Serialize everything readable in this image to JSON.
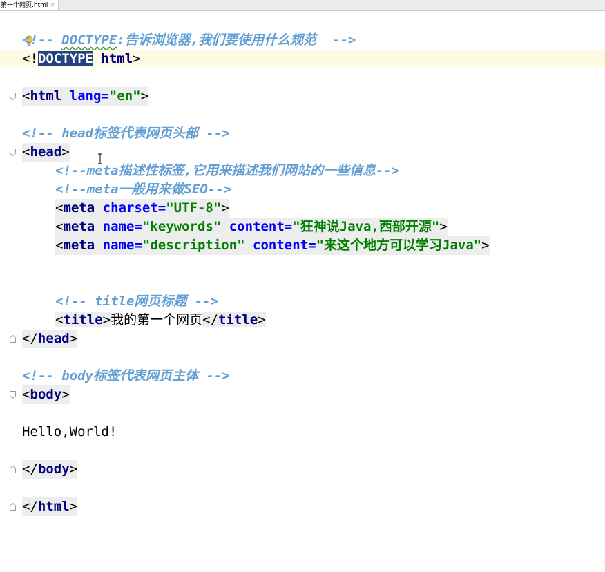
{
  "tab": {
    "title": "第一个网页.html",
    "close": "×"
  },
  "lines": {
    "l1": {
      "a": "<",
      "b": "!-- ",
      "c": "DOCTYPE",
      "d": ":告诉浏览器,我们要使用什么规范  -->"
    },
    "l2": {
      "a": "<!",
      "b": "DOCTYPE",
      "c": " ",
      "d": "html",
      "e": ">"
    },
    "l4": {
      "a": "<",
      "b": "html",
      "c": " ",
      "d": "lang=",
      "e": "\"en\"",
      "f": ">"
    },
    "l6": {
      "text": "<!-- head标签代表网页头部 -->"
    },
    "l7": {
      "a": "<",
      "b": "head",
      "c": ">"
    },
    "l8": {
      "text": "<!--meta描述性标签,它用来描述我们网站的一些信息-->"
    },
    "l9": {
      "text": "<!--meta一般用来做SEO-->"
    },
    "l10": {
      "a": "<",
      "b": "meta",
      "c": " ",
      "d": "charset=",
      "e": "\"UTF-8\"",
      "f": ">"
    },
    "l11": {
      "a": "<",
      "b": "meta",
      "c": " ",
      "d": "name=",
      "e": "\"keywords\"",
      "f": " ",
      "g": "content=",
      "h": "\"狂神说Java,西部开源\"",
      "i": ">"
    },
    "l12": {
      "a": "<",
      "b": "meta",
      "c": " ",
      "d": "name=",
      "e": "\"description\"",
      "f": " ",
      "g": "content=",
      "h": "\"来这个地方可以学习Java\"",
      "i": ">"
    },
    "l15": {
      "text": "<!-- title网页标题 -->"
    },
    "l16": {
      "a": "<",
      "b": "title",
      "c": ">",
      "d": "我的第一个网页",
      "e": "</",
      "f": "title",
      "g": ">"
    },
    "l17": {
      "a": "</",
      "b": "head",
      "c": ">"
    },
    "l19": {
      "text": "<!-- body标签代表网页主体 -->"
    },
    "l20": {
      "a": "<",
      "b": "body",
      "c": ">"
    },
    "l22": {
      "text": "Hello,World!"
    },
    "l24": {
      "a": "</",
      "b": "body",
      "c": ">"
    },
    "l26": {
      "a": "</",
      "b": "html",
      "c": ">"
    }
  },
  "colors": {
    "tag": "#000080",
    "attribute": "#0000ff",
    "value": "#008000",
    "comment": "#629fd4",
    "selection": "#214283",
    "current_line": "#fffae3"
  }
}
